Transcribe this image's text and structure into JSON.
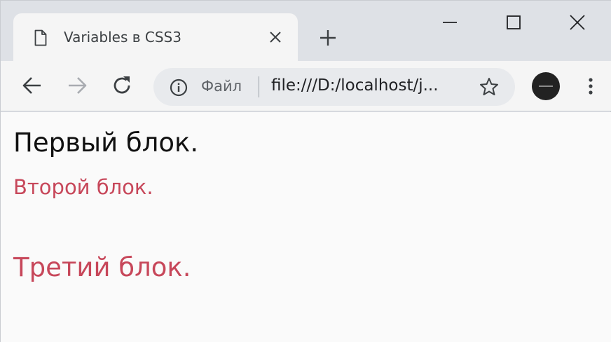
{
  "tab": {
    "title": "Variables в CSS3",
    "favicon_icon": "page-icon",
    "close_icon": "close-icon"
  },
  "window_controls": [
    "minimize-icon",
    "maximize-icon",
    "close-icon"
  ],
  "toolbar": {
    "back_icon": "arrow-left-icon",
    "forward_icon": "arrow-right-icon",
    "reload_icon": "reload-icon",
    "menu_icon": "vertical-dots-icon"
  },
  "omnibox": {
    "scheme_label": "Файл",
    "url": "file:///D:/localhost/j...",
    "info_icon": "info-icon",
    "bookmark_icon": "star-icon"
  },
  "page": {
    "block1": "Первый блок.",
    "block2": "Второй блок.",
    "block3": "Третий блок.",
    "colors": {
      "block1": "#111111",
      "block2": "#c7475a",
      "block3": "#c7475a"
    }
  }
}
